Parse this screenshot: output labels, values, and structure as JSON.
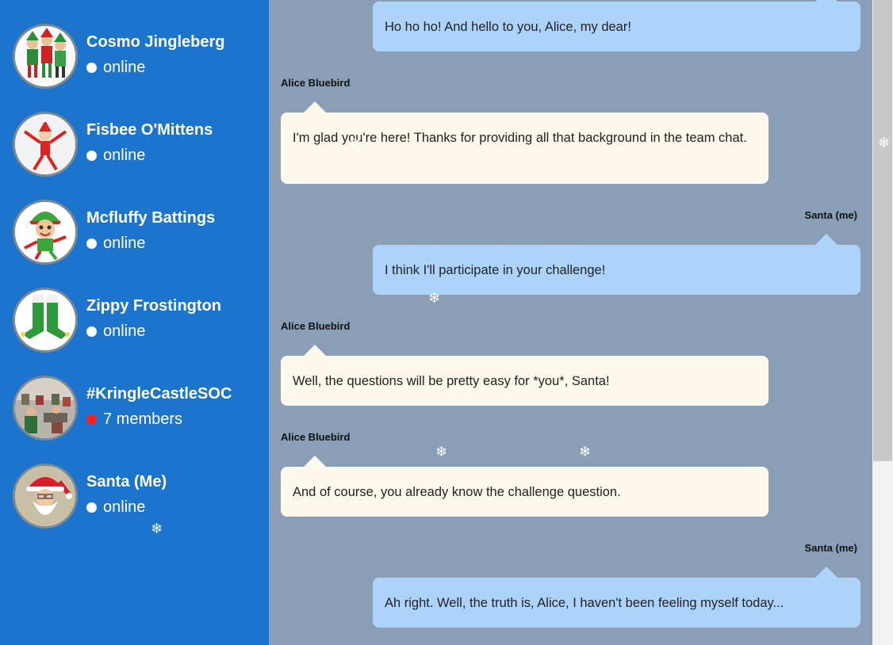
{
  "contacts": [
    {
      "name": "Cosmo Jingleberg",
      "status": "online",
      "status_color": "#ffffff",
      "avatar": "elves-group-avatar"
    },
    {
      "name": "Fisbee O'Mittens",
      "status": "online",
      "status_color": "#ffffff",
      "avatar": "elf-on-shelf-avatar"
    },
    {
      "name": "Mcfluffy Battings",
      "status": "online",
      "status_color": "#ffffff",
      "avatar": "cartoon-elf-avatar"
    },
    {
      "name": "Zippy Frostington",
      "status": "online",
      "status_color": "#ffffff",
      "avatar": "elf-boots-avatar"
    },
    {
      "name": "#KringleCastleSOC",
      "status": "7 members",
      "status_color": "#ff1e1e",
      "avatar": "group-photo-avatar"
    },
    {
      "name": "Santa (Me)",
      "status": "online",
      "status_color": "#ffffff",
      "avatar": "santa-avatar"
    }
  ],
  "messages": [
    {
      "from": "me",
      "sender": "",
      "text": "Ho ho ho! And hello to you, Alice, my dear!"
    },
    {
      "from": "them",
      "sender": "Alice Bluebird",
      "text": "I'm glad you're here! Thanks for providing all that background in the team chat."
    },
    {
      "from": "me",
      "sender": "Santa (me)",
      "text": "I think I'll participate in your challenge!"
    },
    {
      "from": "them",
      "sender": "Alice Bluebird",
      "text": "Well, the questions will be pretty easy for *you*, Santa!"
    },
    {
      "from": "them",
      "sender": "Alice Bluebird",
      "text": "And of course, you already know the challenge question."
    },
    {
      "from": "me",
      "sender": "Santa (me)",
      "text": "Ah right. Well, the truth is, Alice, I haven't been feeling myself today..."
    }
  ],
  "colors": {
    "sidebar": "#1d74cc",
    "chat_background": "#8a9fb5",
    "my_bubble": "#aed3fb",
    "their_bubble": "#fdf8ec"
  },
  "decorations": {
    "snowflake": "❄"
  }
}
